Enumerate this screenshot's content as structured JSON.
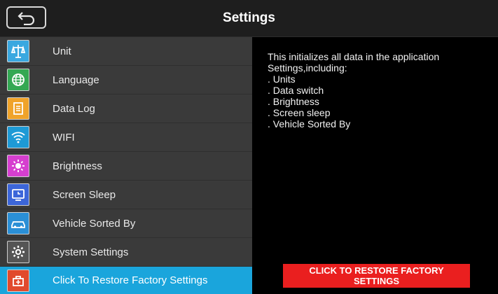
{
  "header": {
    "title": "Settings"
  },
  "sidebar": {
    "items": [
      {
        "label": "Unit",
        "icon": "scale-icon",
        "color": "#3aa8e0"
      },
      {
        "label": "Language",
        "icon": "globe-icon",
        "color": "#34a853"
      },
      {
        "label": "Data Log",
        "icon": "document-icon",
        "color": "#f0a32a"
      },
      {
        "label": "WIFI",
        "icon": "wifi-icon",
        "color": "#1e9ad6"
      },
      {
        "label": "Brightness",
        "icon": "sun-icon",
        "color": "#d63fcf"
      },
      {
        "label": "Screen Sleep",
        "icon": "clock-icon",
        "color": "#3c66d9"
      },
      {
        "label": "Vehicle Sorted By",
        "icon": "car-icon",
        "color": "#2a8fd6"
      },
      {
        "label": "System Settings",
        "icon": "gear-icon",
        "color": "#555555"
      },
      {
        "label": "Click To Restore Factory Settings",
        "icon": "restore-icon",
        "color": "#e14a2d",
        "active": true
      }
    ]
  },
  "main": {
    "description": {
      "line1": "This initializes all data in the application",
      "line2": "Settings,including:",
      "line3": ". Units",
      "line4": ". Data switch",
      "line5": ". Brightness",
      "line6": ". Screen sleep",
      "line7": ". Vehicle Sorted By"
    },
    "restore_button": "CLICK TO RESTORE FACTORY SETTINGS"
  },
  "colors": {
    "accent": "#1aa5dc",
    "danger": "#ea1f1f"
  }
}
